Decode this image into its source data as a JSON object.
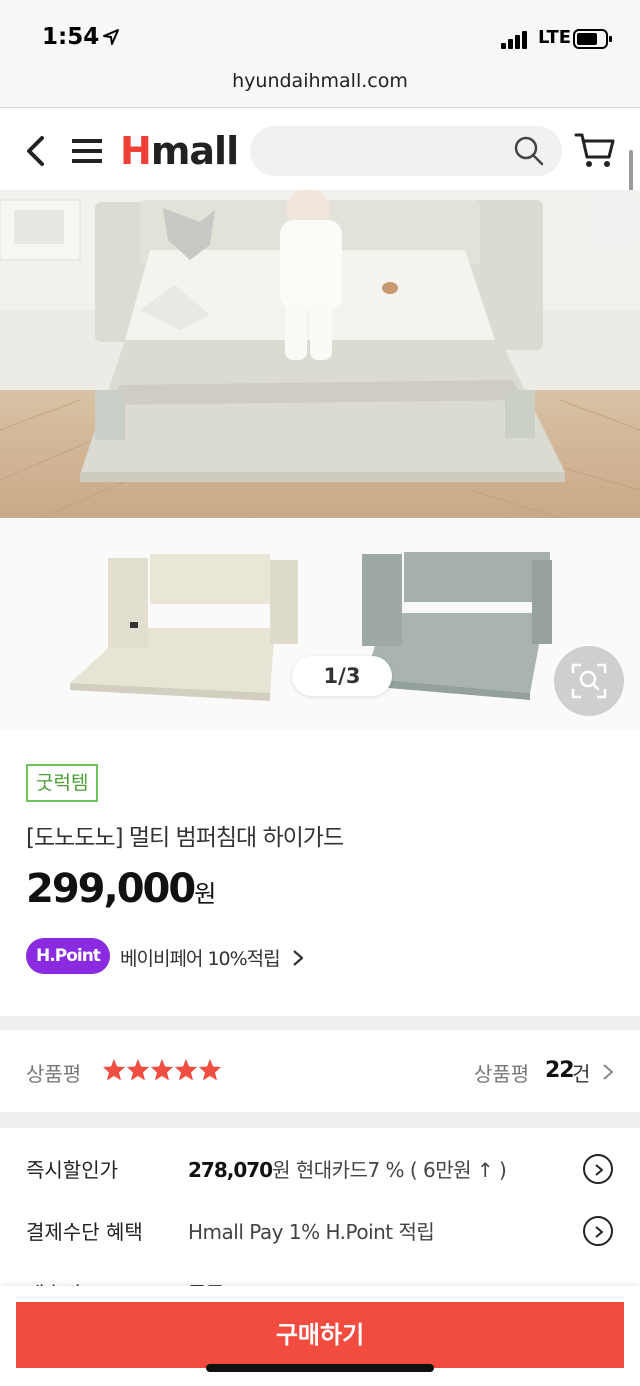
{
  "status_bar": {
    "time": "1:54",
    "network": "LTE"
  },
  "browser": {
    "url": "hyundaihmall.com"
  },
  "header": {
    "logo_h": "H",
    "logo_rest": "mall",
    "search_placeholder": ""
  },
  "gallery": {
    "counter": "1/3"
  },
  "product": {
    "badge": "굿럭템",
    "name": "[도노도노] 멀티 범퍼침대 하이가드",
    "price": "299,000",
    "price_unit": "원",
    "hpoint_label": "H.Point",
    "hpoint_text": "베이비페어 10%적립"
  },
  "reviews": {
    "label": "상품평",
    "rating": 5,
    "count_label": "상품평",
    "count": "22",
    "count_unit": "건"
  },
  "benefits": [
    {
      "label": "즉시할인가",
      "price": "278,070",
      "detail": "원 현대카드7 % ( 6만원 ↑ )"
    },
    {
      "label": "결제수단 혜택",
      "detail": "Hmall Pay 1% H.Point 적립"
    },
    {
      "label": "배송비",
      "detail": "무료"
    }
  ],
  "bottom": {
    "buy_label": "구매하기"
  },
  "colors": {
    "accent": "#f24c40",
    "hpoint": "#8a2be2",
    "star": "#f04e42",
    "badge": "#6ec35a"
  }
}
